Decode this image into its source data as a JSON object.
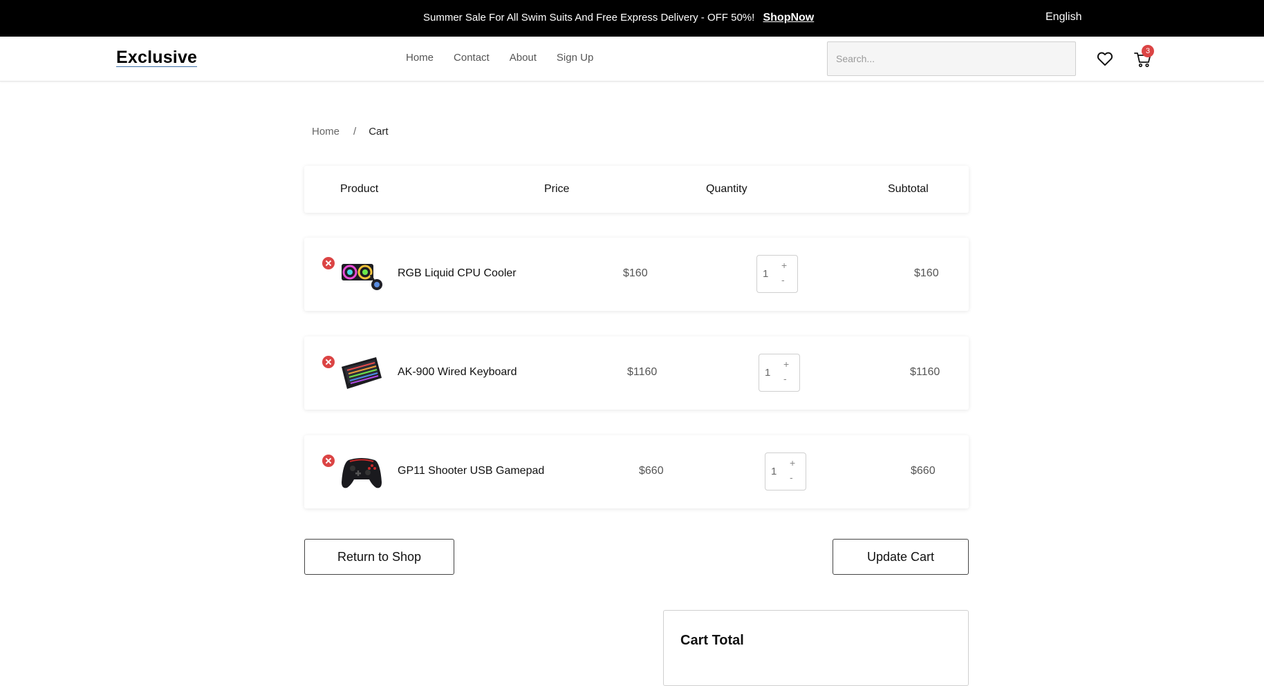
{
  "banner": {
    "text": "Summer Sale For All Swim Suits And Free Express Delivery - OFF 50%!",
    "link": "ShopNow",
    "language": "English"
  },
  "header": {
    "logo": "Exclusive",
    "nav": [
      "Home",
      "Contact",
      "About",
      "Sign Up"
    ],
    "search_placeholder": "Search...",
    "cart_count": "3"
  },
  "breadcrumb": {
    "home": "Home",
    "separator": "/",
    "current": "Cart"
  },
  "table": {
    "headers": {
      "product": "Product",
      "price": "Price",
      "quantity": "Quantity",
      "subtotal": "Subtotal"
    },
    "rows": [
      {
        "name": "RGB Liquid CPU Cooler",
        "price": "$160",
        "quantity": "1",
        "subtotal": "$160"
      },
      {
        "name": "AK-900 Wired Keyboard",
        "price": "$1160",
        "quantity": "1",
        "subtotal": "$1160"
      },
      {
        "name": "GP11 Shooter USB Gamepad",
        "price": "$660",
        "quantity": "1",
        "subtotal": "$660"
      }
    ],
    "qty_plus": "+",
    "qty_minus": "-"
  },
  "buttons": {
    "return": "Return to Shop",
    "update": "Update Cart"
  },
  "cart_total": {
    "title": "Cart Total"
  },
  "colors": {
    "accent": "#db4444",
    "banner_bg": "#000000"
  }
}
